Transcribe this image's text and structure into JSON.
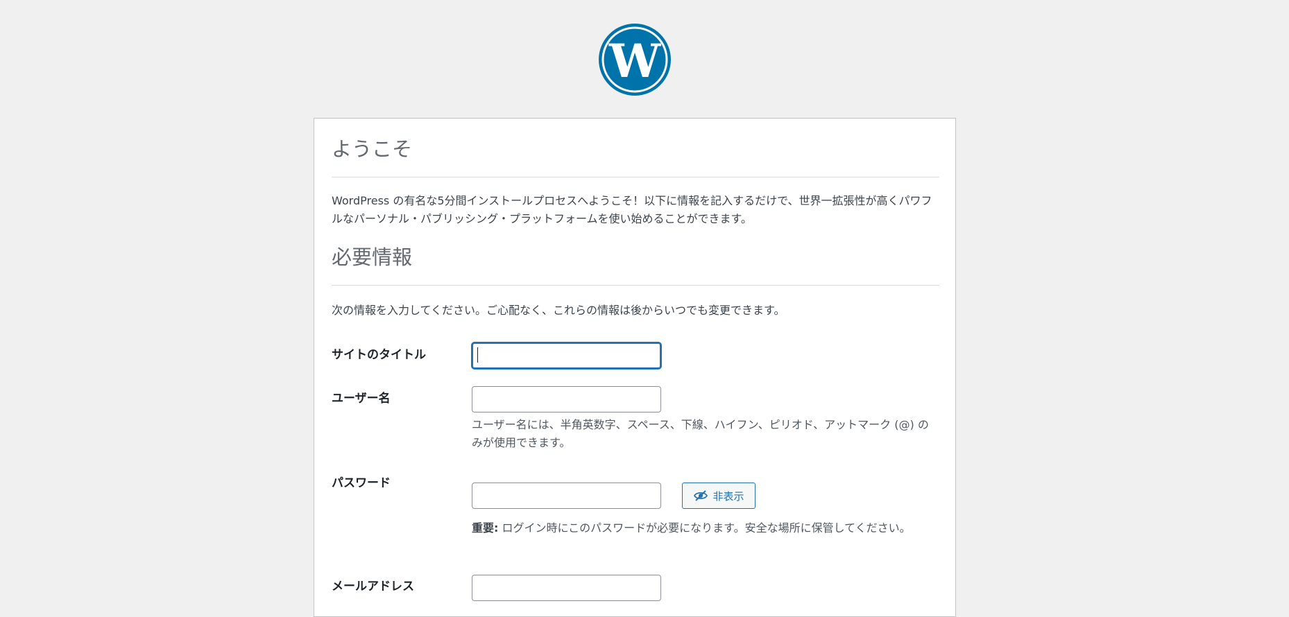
{
  "logo": {
    "name": "wordpress-logo",
    "color": "#0073aa"
  },
  "welcome": {
    "title": "ようこそ",
    "intro": "WordPress の有名な5分間インストールプロセスへようこそ！以下に情報を記入するだけで、世界一拡張性が高くパワフルなパーソナル・パブリッシング・プラットフォームを使い始めることができます。"
  },
  "required": {
    "title": "必要情報",
    "note": "次の情報を入力してください。ご心配なく、これらの情報は後からいつでも変更できます。"
  },
  "form": {
    "site_title_label": "サイトのタイトル",
    "site_title_value": "",
    "username_label": "ユーザー名",
    "username_value": "",
    "username_hint": "ユーザー名には、半角英数字、スペース、下線、ハイフン、ピリオド、アットマーク (@) のみが使用できます。",
    "password_label": "パスワード",
    "password_value": "",
    "password_toggle_label": "非表示",
    "password_hint_strong": "重要:",
    "password_hint": " ログイン時にこのパスワードが必要になります。安全な場所に保管してください。",
    "email_label": "メールアドレス",
    "email_value": ""
  },
  "colors": {
    "accent": "#2271b1",
    "background": "#f0f0f1"
  }
}
